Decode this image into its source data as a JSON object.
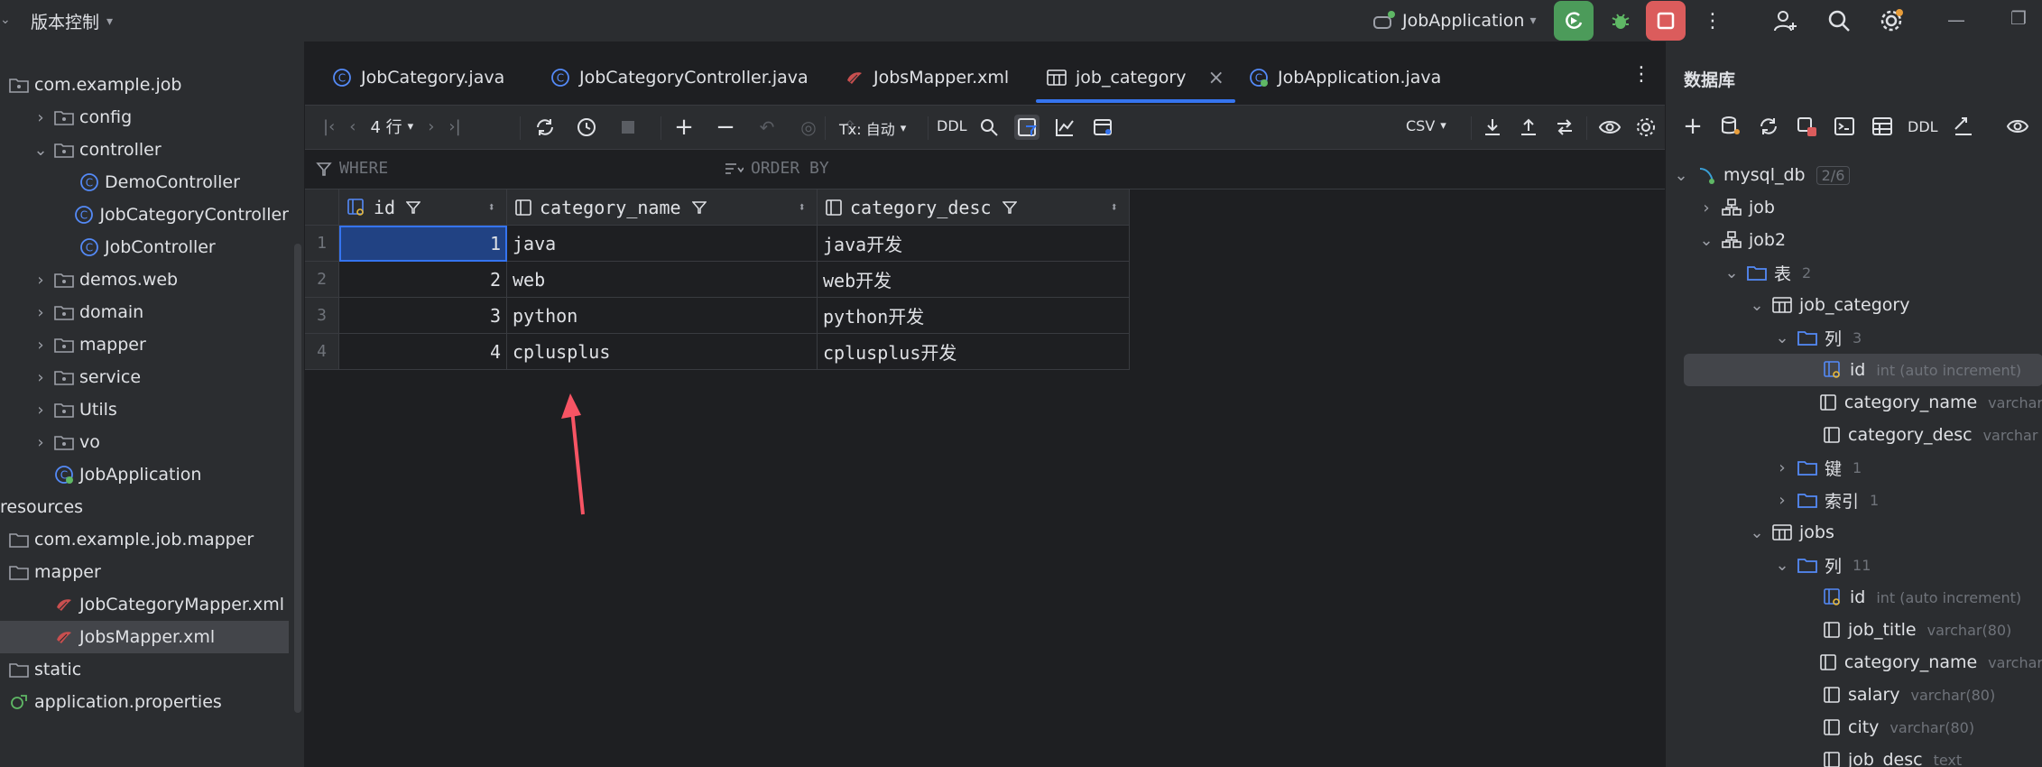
{
  "titlebar": {
    "vcs_label": "版本控制",
    "run_config": "JobApplication"
  },
  "project_tree": [
    {
      "label": "com.example.job",
      "indent": 0,
      "kind": "package",
      "chev": ""
    },
    {
      "label": "config",
      "indent": 1,
      "kind": "package",
      "chev": "right"
    },
    {
      "label": "controller",
      "indent": 1,
      "kind": "package",
      "chev": "down"
    },
    {
      "label": "DemoController",
      "indent": 2,
      "kind": "class",
      "chev": ""
    },
    {
      "label": "JobCategoryController",
      "indent": 2,
      "kind": "class",
      "chev": ""
    },
    {
      "label": "JobController",
      "indent": 2,
      "kind": "class",
      "chev": ""
    },
    {
      "label": "demos.web",
      "indent": 1,
      "kind": "package",
      "chev": "right"
    },
    {
      "label": "domain",
      "indent": 1,
      "kind": "package",
      "chev": "right"
    },
    {
      "label": "mapper",
      "indent": 1,
      "kind": "package",
      "chev": "right"
    },
    {
      "label": "service",
      "indent": 1,
      "kind": "package",
      "chev": "right"
    },
    {
      "label": "Utils",
      "indent": 1,
      "kind": "package",
      "chev": "right"
    },
    {
      "label": "vo",
      "indent": 1,
      "kind": "package",
      "chev": "right"
    },
    {
      "label": "JobApplication",
      "indent": 1,
      "kind": "springclass",
      "chev": ""
    },
    {
      "label": "resources",
      "indent": -1,
      "kind": "none",
      "chev": ""
    },
    {
      "label": "com.example.job.mapper",
      "indent": 0,
      "kind": "folder",
      "chev": ""
    },
    {
      "label": "mapper",
      "indent": 0,
      "kind": "folder",
      "chev": ""
    },
    {
      "label": "JobCategoryMapper.xml",
      "indent": 1,
      "kind": "xml",
      "chev": ""
    },
    {
      "label": "JobsMapper.xml",
      "indent": 1,
      "kind": "xml",
      "chev": "",
      "selected": true
    },
    {
      "label": "static",
      "indent": 0,
      "kind": "folder",
      "chev": ""
    },
    {
      "label": "application.properties",
      "indent": 0,
      "kind": "props",
      "chev": ""
    }
  ],
  "tabs": [
    {
      "label": "JobCategory.java",
      "kind": "class"
    },
    {
      "label": "JobCategoryController.java",
      "kind": "class"
    },
    {
      "label": "JobsMapper.xml",
      "kind": "xml"
    },
    {
      "label": "job_category",
      "kind": "table",
      "active": true
    },
    {
      "label": "JobApplication.java",
      "kind": "springclass"
    }
  ],
  "toolbar": {
    "rows_label": "4 行",
    "tx_label": "Tx: 自动",
    "ddl_label": "DDL",
    "export_format": "CSV"
  },
  "filterbar": {
    "where": "WHERE",
    "order_by": "ORDER BY"
  },
  "grid": {
    "columns": [
      "id",
      "category_name",
      "category_desc"
    ],
    "rows": [
      {
        "num": "1",
        "id": "1",
        "category_name": "java",
        "category_desc": "java开发"
      },
      {
        "num": "2",
        "id": "2",
        "category_name": "web",
        "category_desc": "web开发"
      },
      {
        "num": "3",
        "id": "3",
        "category_name": "python",
        "category_desc": "python开发"
      },
      {
        "num": "4",
        "id": "4",
        "category_name": "cplusplus",
        "category_desc": "cplusplus开发"
      }
    ]
  },
  "dbpanel": {
    "title": "数据库",
    "ddl_label": "DDL",
    "tree": [
      {
        "label": "mysql_db",
        "extra": "2/6",
        "indent": 0,
        "chev": "down",
        "kind": "db"
      },
      {
        "label": "job",
        "extra": "",
        "indent": 1,
        "chev": "right",
        "kind": "schema"
      },
      {
        "label": "job2",
        "extra": "",
        "indent": 1,
        "chev": "down",
        "kind": "schema"
      },
      {
        "label": "表",
        "extra": "2",
        "indent": 2,
        "chev": "down",
        "kind": "folder"
      },
      {
        "label": "job_category",
        "extra": "",
        "indent": 3,
        "chev": "down",
        "kind": "table"
      },
      {
        "label": "列",
        "extra": "3",
        "indent": 4,
        "chev": "down",
        "kind": "folder"
      },
      {
        "label": "id",
        "extra": "int (auto increment)",
        "indent": 5,
        "chev": "",
        "kind": "keycol",
        "selected": true
      },
      {
        "label": "category_name",
        "extra": "varchar",
        "indent": 5,
        "chev": "",
        "kind": "col"
      },
      {
        "label": "category_desc",
        "extra": "varchar",
        "indent": 5,
        "chev": "",
        "kind": "col"
      },
      {
        "label": "键",
        "extra": "1",
        "indent": 4,
        "chev": "right",
        "kind": "folder"
      },
      {
        "label": "索引",
        "extra": "1",
        "indent": 4,
        "chev": "right",
        "kind": "folder"
      },
      {
        "label": "jobs",
        "extra": "",
        "indent": 3,
        "chev": "down",
        "kind": "table"
      },
      {
        "label": "列",
        "extra": "11",
        "indent": 4,
        "chev": "down",
        "kind": "folder"
      },
      {
        "label": "id",
        "extra": "int (auto increment)",
        "indent": 5,
        "chev": "",
        "kind": "keycol"
      },
      {
        "label": "job_title",
        "extra": "varchar(80)",
        "indent": 5,
        "chev": "",
        "kind": "col"
      },
      {
        "label": "category_name",
        "extra": "varchar",
        "indent": 5,
        "chev": "",
        "kind": "col"
      },
      {
        "label": "salary",
        "extra": "varchar(80)",
        "indent": 5,
        "chev": "",
        "kind": "col"
      },
      {
        "label": "city",
        "extra": "varchar(80)",
        "indent": 5,
        "chev": "",
        "kind": "col"
      },
      {
        "label": "job_desc",
        "extra": "text",
        "indent": 5,
        "chev": "",
        "kind": "col"
      }
    ]
  },
  "colors": {
    "accent": "#3574f0",
    "run_green": "#4c9b5a",
    "stop_red": "#db5c5c",
    "class_icon": "#548af7",
    "arrow": "#f75464"
  }
}
